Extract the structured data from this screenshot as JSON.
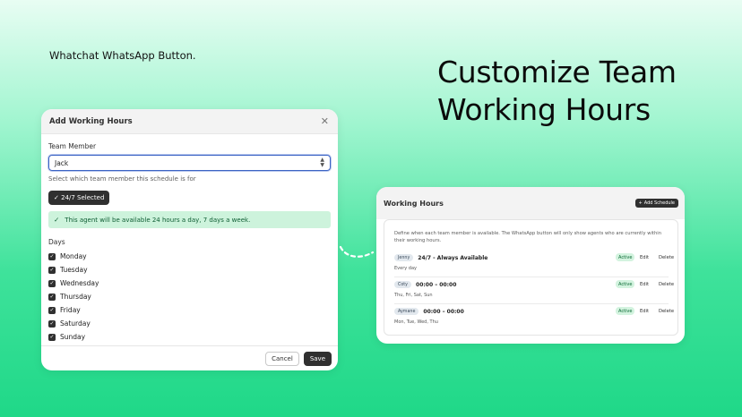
{
  "brand": "Whatchat WhatsApp Button.",
  "headline": {
    "line1": "Customize Team",
    "line2": "Working Hours"
  },
  "modal": {
    "title": "Add Working Hours",
    "team_member_label": "Team Member",
    "team_member_value": "Jack",
    "help_text": "Select which team member this schedule is for",
    "mode_button": "24/7 Selected",
    "mode_check": "✓",
    "banner_text": "This agent will be available 24 hours a day, 7 days a week.",
    "days_label": "Days",
    "days": [
      "Monday",
      "Tuesday",
      "Wednesday",
      "Thursday",
      "Friday",
      "Saturday",
      "Sunday"
    ],
    "cancel_label": "Cancel",
    "save_label": "Save"
  },
  "working_hours": {
    "title": "Working Hours",
    "add_label": "Add Schedule",
    "description": "Define when each team member is available. The WhatsApp button will only show agents who are currently within their working hours.",
    "rows": [
      {
        "name": "Jenny",
        "hours": "24/7 - Always Available",
        "days": "Every day",
        "status": "Active",
        "edit": "Edit",
        "delete": "Delete"
      },
      {
        "name": "Coty",
        "hours": "00:00 – 00:00",
        "days": "Thu, Fri, Sat, Sun",
        "status": "Active",
        "edit": "Edit",
        "delete": "Delete"
      },
      {
        "name": "Aymane",
        "hours": "00:00 – 00:00",
        "days": "Mon, Tue, Wed, Thu",
        "status": "Active",
        "edit": "Edit",
        "delete": "Delete"
      }
    ]
  },
  "icons": {
    "close": "close-icon",
    "chevron": "chevron-up-down-icon",
    "check": "check-icon",
    "plus": "plus-icon"
  },
  "colors": {
    "accent_dark": "#303030",
    "focus_blue": "#3b63c4",
    "success_bg": "#cdf3dc",
    "success_text": "#0d5c32",
    "background_green": "#3fe29b"
  }
}
